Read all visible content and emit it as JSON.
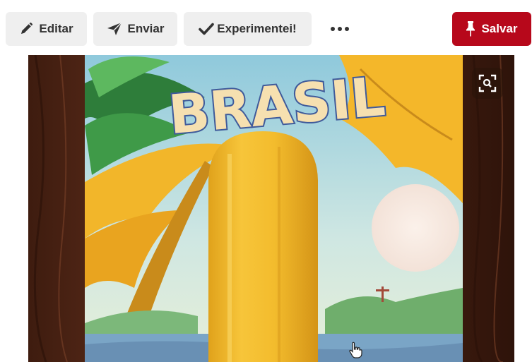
{
  "toolbar": {
    "edit_label": "Editar",
    "send_label": "Enviar",
    "tried_label": "Experimentei!",
    "save_label": "Salvar"
  },
  "image": {
    "poster_title": "BRASIL"
  },
  "colors": {
    "save_button": "#b7081b",
    "secondary_button": "#efefef",
    "button_text": "#333333"
  },
  "icons": {
    "edit": "pencil-icon",
    "send": "paper-plane-icon",
    "tried": "checkmark-icon",
    "more": "ellipsis-icon",
    "save": "pin-icon",
    "zoom": "visual-search-icon"
  }
}
